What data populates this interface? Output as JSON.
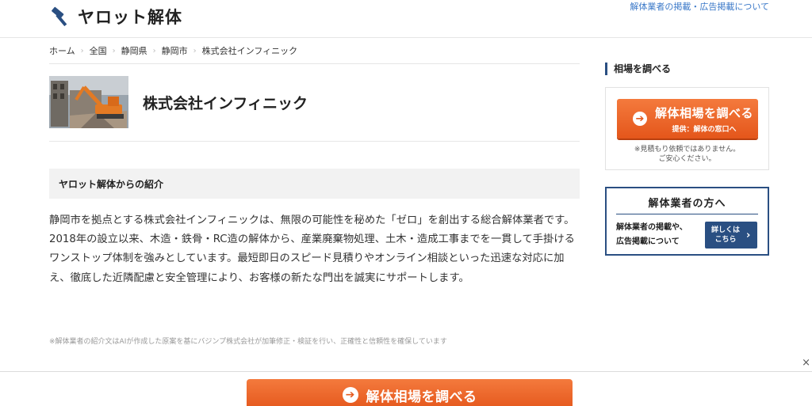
{
  "header": {
    "logo_text": "ヤロット解体",
    "logo_icon": "hammer-icon",
    "link_text": "解体業者の掲載・広告掲載について"
  },
  "breadcrumb": {
    "items": [
      "ホーム",
      "全国",
      "静岡県",
      "静岡市",
      "株式会社インフィニック"
    ],
    "separator": "›"
  },
  "company": {
    "name": "株式会社インフィニック",
    "photo_icon": "demolition-photo"
  },
  "intro": {
    "heading": "ヤロット解体からの紹介",
    "body": "静岡市を拠点とする株式会社インフィニックは、無限の可能性を秘めた「ゼロ」を創出する総合解体業者です。2018年の設立以来、木造・鉄骨・RC造の解体から、産業廃棄物処理、土木・造成工事までを一貫して手掛けるワンストップ体制を強みとしています。最短即日のスピード見積りやオンライン相談といった迅速な対応に加え、徹底した近隣配慮と安全管理により、お客様の新たな門出を誠実にサポートします。",
    "note": "※解体業者の紹介文はAIが作成した原案を基にバジンプ株式会社が加筆修正・検証を行い、正確性と信頼性を確保しています"
  },
  "sidebar": {
    "heading": "相場を調べる",
    "quote_button": {
      "main": "解体相場を調べる",
      "sub": "提供：解体の窓口へ",
      "icon": "arrow-right-circle-icon"
    },
    "quote_note_line1": "※見積もり依頼ではありません。",
    "quote_note_line2": "ご安心ください。",
    "pro_card": {
      "title": "解体業者の方へ",
      "text_line1": "解体業者の掲載や、",
      "text_line2": "広告掲載について",
      "button_line1": "詳しくは",
      "button_line2": "こちら",
      "button_icon": "chevron-right-icon"
    }
  },
  "bottom_bar": {
    "button_label": "解体相場を調べる",
    "button_icon": "arrow-right-circle-icon",
    "close_label": "×"
  },
  "colors": {
    "accent_orange": "#e4561b",
    "navy": "#2a4f82",
    "link_blue": "#3a78c8"
  }
}
